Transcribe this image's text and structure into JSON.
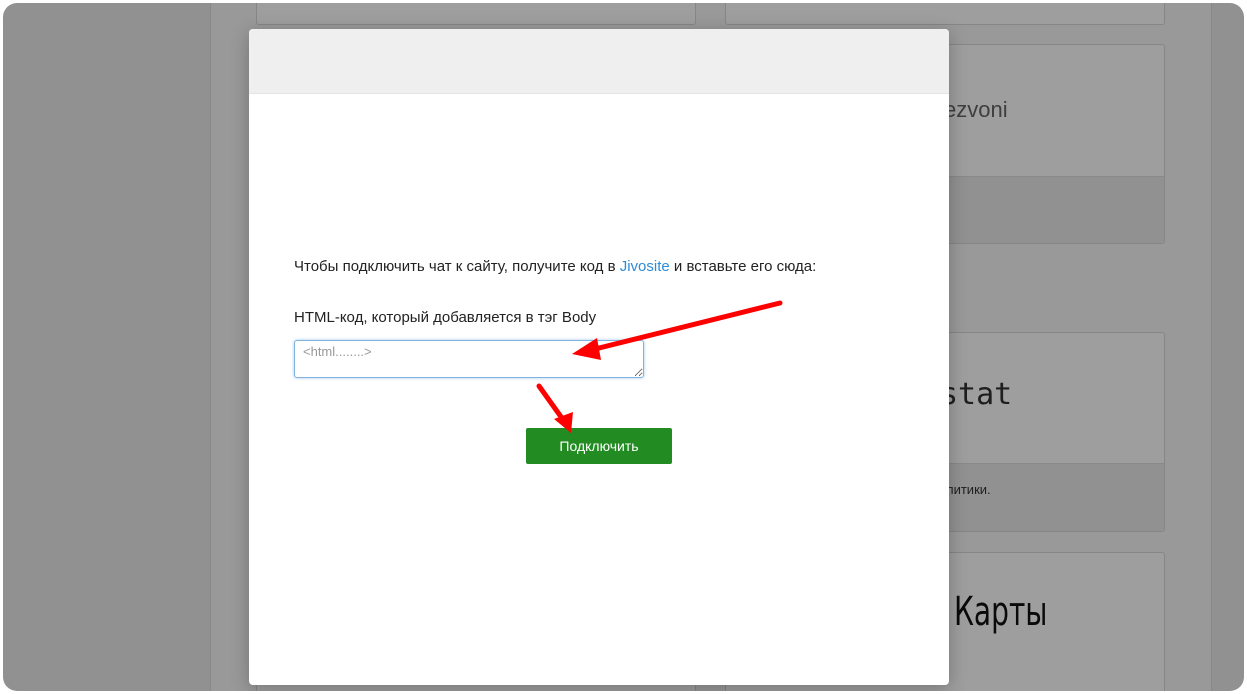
{
  "background": {
    "card_logos": [
      "ezvoni",
      "stat",
      "Карты"
    ],
    "card_text": "литики."
  },
  "modal": {
    "intro_before": "Чтобы подключить чат к сайту, получите код в ",
    "intro_link": "Jivosite",
    "intro_after": " и вставьте его сюда:",
    "field_label": "HTML-код, который добавляется в тэг Body",
    "field_placeholder": "<html........>",
    "field_value": "",
    "connect_label": "Подключить"
  },
  "colors": {
    "accent_button": "#228b22",
    "link": "#2e8bd6",
    "annotation_arrow": "#ff0000"
  }
}
